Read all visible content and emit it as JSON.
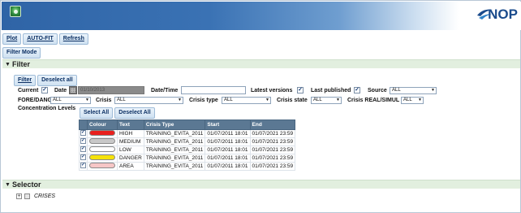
{
  "brand": {
    "name": "NOP",
    "accent": "#1a4b8c"
  },
  "toolbar": {
    "plot": "Plot",
    "autofit": "AUTO-FIT",
    "refresh": "Refresh"
  },
  "filter_mode": "Filter Mode",
  "filter_section": {
    "title": "Filter",
    "filter_btn": "Filter",
    "deselect_all": "Deselect all",
    "current_label": "Current",
    "current_checked": true,
    "date_label": "Date",
    "date_value": "01/10/2013",
    "datetime_label": "Date/Time",
    "datetime_value": "",
    "latest_versions_label": "Latest versions",
    "latest_versions_checked": true,
    "last_published_label": "Last published",
    "last_published_checked": true,
    "source_label": "Source",
    "source_value": "ALL",
    "fore_dang_label": "FORE/DANG",
    "fore_dang_value": "ALL",
    "crisis_label": "Crisis",
    "crisis_value": "ALL",
    "crisis_type_label": "Crisis type",
    "crisis_type_value": "ALL",
    "crisis_state_label": "Crisis state",
    "crisis_state_value": "ALL",
    "crisis_real_label": "Crisis REAL/SIMUL",
    "crisis_real_value": "ALL",
    "conc_levels_label": "Concentration Levels",
    "select_all": "Select All",
    "deselect_all_levels": "Deselect All"
  },
  "levels_table": {
    "headers": [
      "Colour",
      "Text",
      "Crisis Type",
      "Start",
      "End"
    ],
    "rows": [
      {
        "color": "#e8201e",
        "text": "HIGH",
        "crisis_type": "TRAINING_EVITA_2011",
        "start": "01/07/2011 18:01",
        "end": "01/07/2021 23:59"
      },
      {
        "color": "#c8c8c8",
        "text": "MEDIUM",
        "crisis_type": "TRAINING_EVITA_2011",
        "start": "01/07/2011 18:01",
        "end": "01/07/2021 23:59"
      },
      {
        "color": "#ffffff",
        "text": "LOW",
        "crisis_type": "TRAINING_EVITA_2011",
        "start": "01/07/2011 18:01",
        "end": "01/07/2021 23:59"
      },
      {
        "color": "#f5e20a",
        "text": "DANGER",
        "crisis_type": "TRAINING_EVITA_2011",
        "start": "01/07/2011 18:01",
        "end": "01/07/2021 23:59"
      },
      {
        "color": "#f6c6c6",
        "text": "AREA",
        "crisis_type": "TRAINING_EVITA_2011",
        "start": "01/07/2011 18:01",
        "end": "01/07/2021 23:59"
      }
    ]
  },
  "selector_section": {
    "title": "Selector",
    "tree_item": "CRISES"
  }
}
